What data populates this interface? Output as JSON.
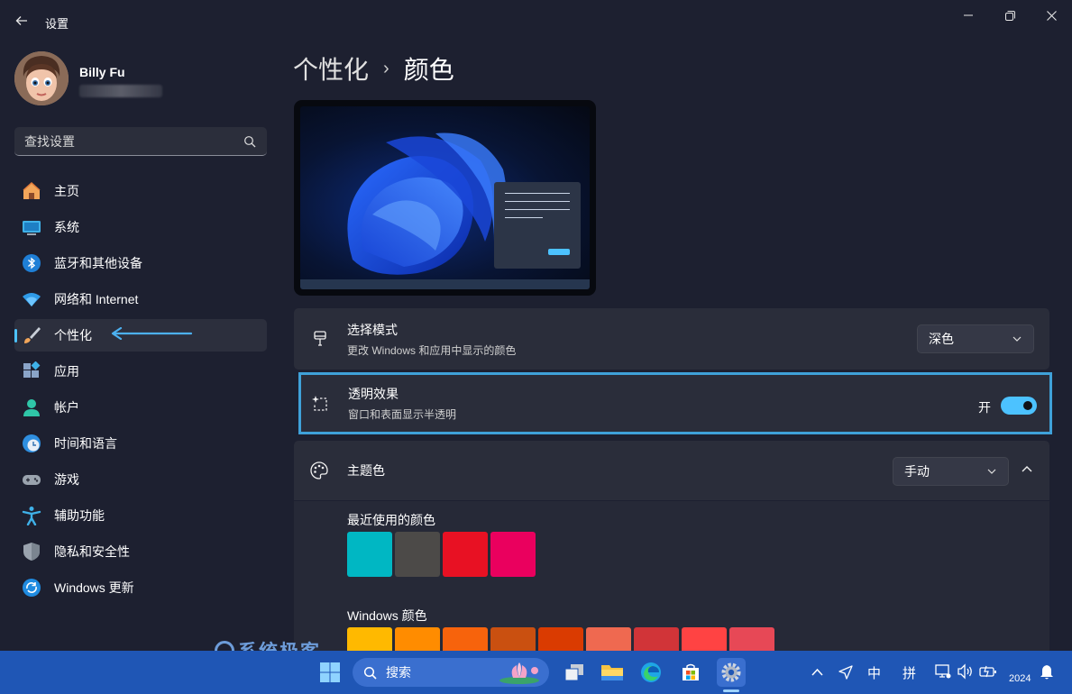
{
  "window": {
    "title": "设置",
    "back_icon": "back-arrow-icon",
    "controls": [
      "minimize-icon",
      "restore-icon",
      "close-icon"
    ]
  },
  "profile": {
    "name": "Billy Fu"
  },
  "search": {
    "placeholder": "查找设置"
  },
  "sidebar": {
    "items": [
      {
        "label": "主页",
        "icon": "home-icon",
        "active": false
      },
      {
        "label": "系统",
        "icon": "system-icon",
        "active": false
      },
      {
        "label": "蓝牙和其他设备",
        "icon": "bluetooth-icon",
        "active": false
      },
      {
        "label": "网络和 Internet",
        "icon": "wifi-icon",
        "active": false
      },
      {
        "label": "个性化",
        "icon": "brush-icon",
        "active": true
      },
      {
        "label": "应用",
        "icon": "apps-icon",
        "active": false
      },
      {
        "label": "帐户",
        "icon": "account-icon",
        "active": false
      },
      {
        "label": "时间和语言",
        "icon": "time-language-icon",
        "active": false
      },
      {
        "label": "游戏",
        "icon": "gamepad-icon",
        "active": false
      },
      {
        "label": "辅助功能",
        "icon": "accessibility-icon",
        "active": false
      },
      {
        "label": "隐私和安全性",
        "icon": "shield-icon",
        "active": false
      },
      {
        "label": "Windows 更新",
        "icon": "windows-update-icon",
        "active": false
      }
    ]
  },
  "breadcrumb": {
    "parent": "个性化",
    "separator": "›",
    "current": "颜色"
  },
  "mode": {
    "title": "选择模式",
    "description": "更改 Windows 和应用中显示的颜色",
    "value": "深色"
  },
  "transparency": {
    "title": "透明效果",
    "description": "窗口和表面显示半透明",
    "state_label": "开",
    "on": true
  },
  "accent": {
    "title": "主题色",
    "value": "手动",
    "recent_label": "最近使用的颜色",
    "recent_colors": [
      "#00b7c3",
      "#4c4a48",
      "#e81123",
      "#ea005e"
    ],
    "windows_label": "Windows 颜色",
    "windows_colors": [
      "#ffb900",
      "#ff8c00",
      "#f7630c",
      "#ca5010",
      "#da3b01",
      "#ef6950",
      "#d13438",
      "#ff4343",
      "#e74856"
    ]
  },
  "watermark": {
    "text": "系统极客"
  },
  "taskbar": {
    "search_label": "搜索",
    "ime_mode": "中",
    "ime_name": "拼",
    "clock": "2024"
  },
  "colors": {
    "accent": "#4cc2ff",
    "background": "#1d2030",
    "card": "#2a2d3a",
    "taskbar": "#1f56b5"
  }
}
